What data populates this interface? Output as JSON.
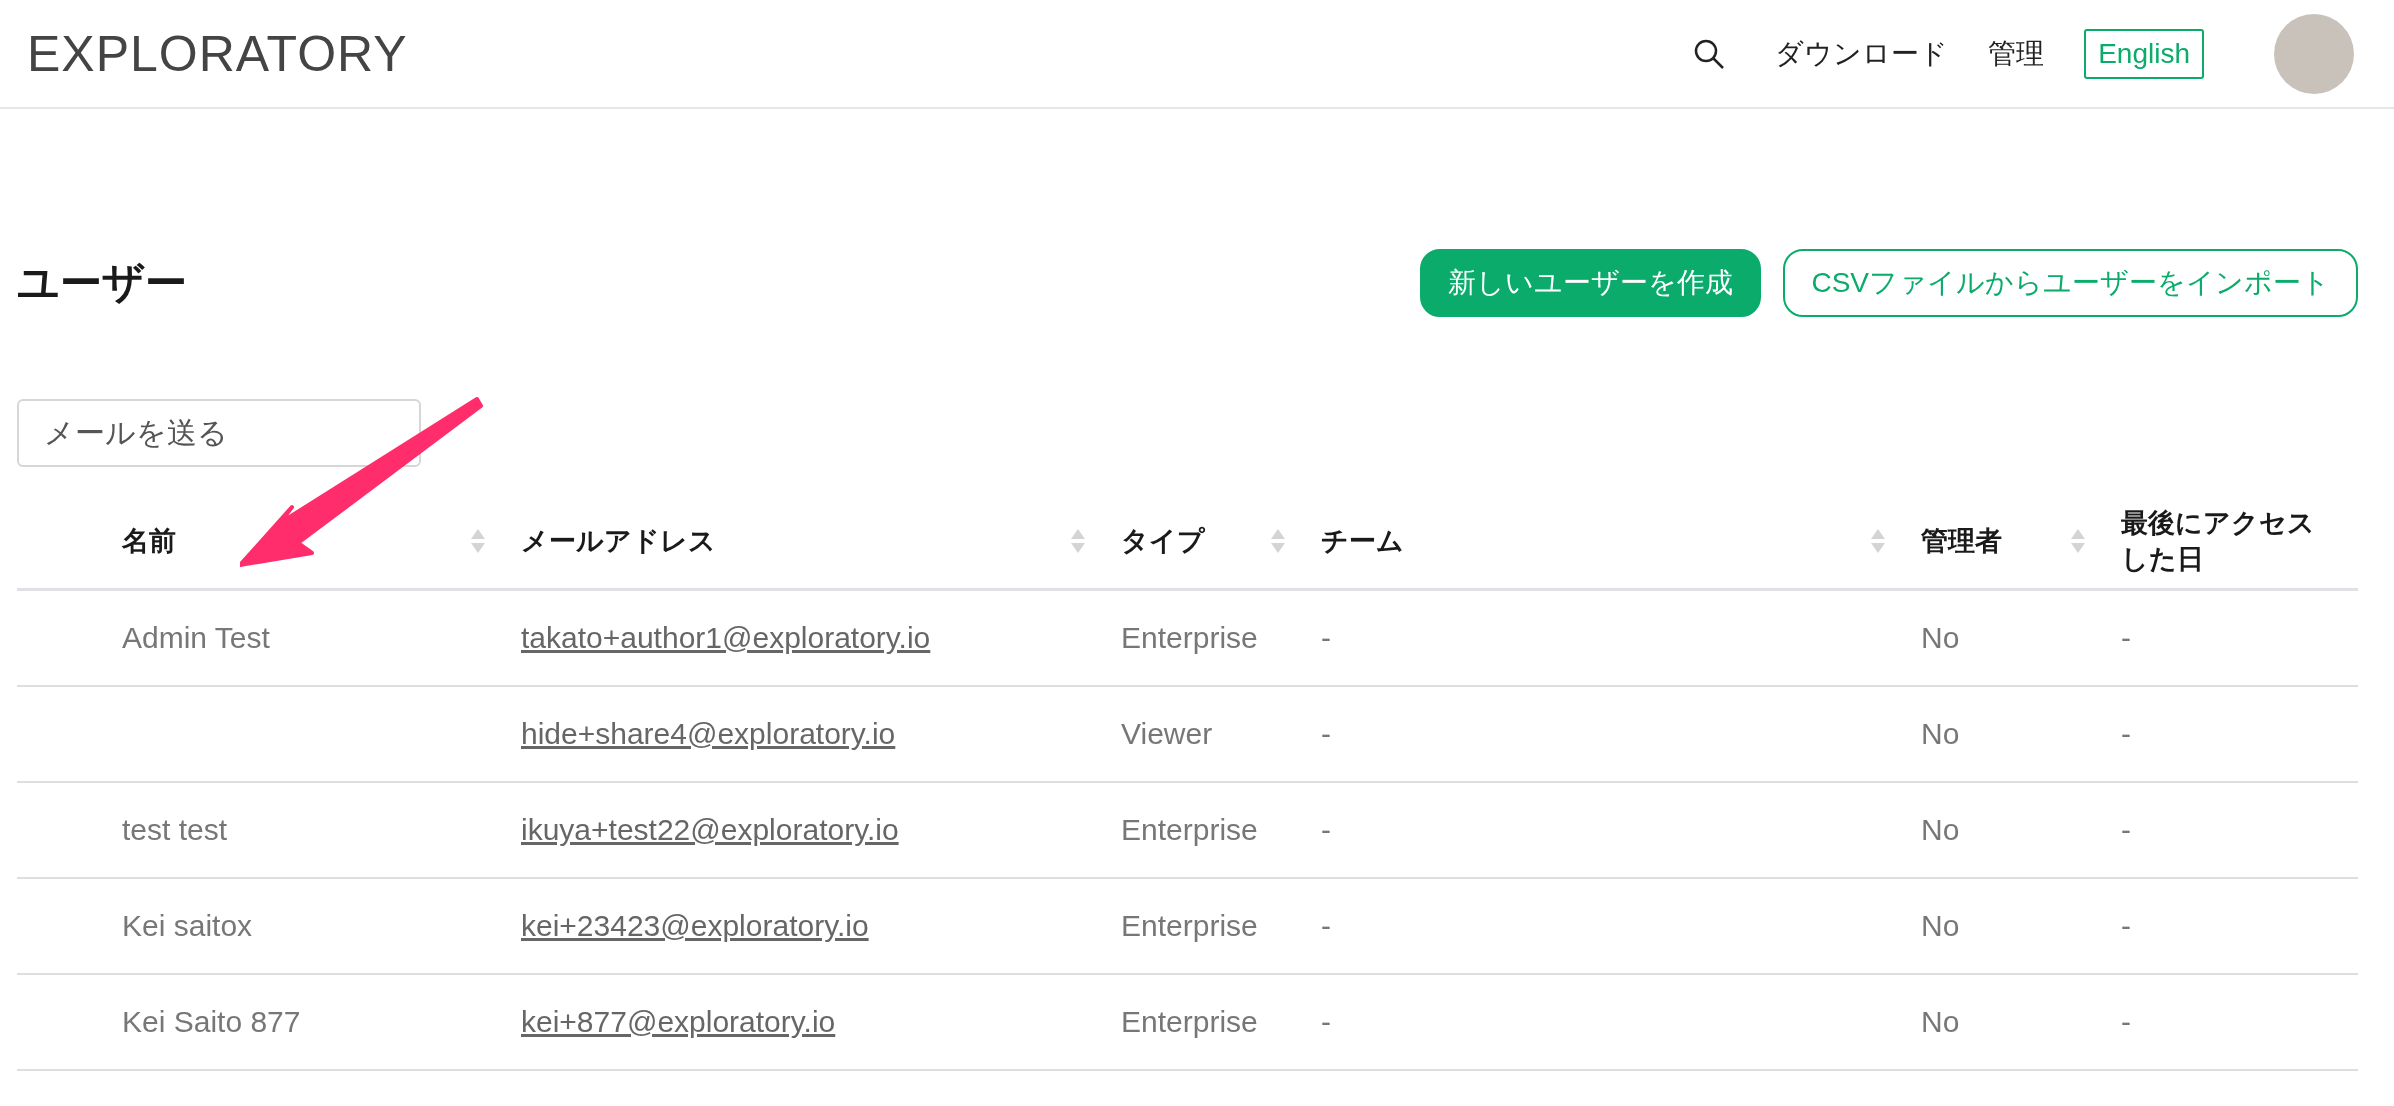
{
  "header": {
    "logo": "EXPLORATORY",
    "nav": [
      "ダウンロード",
      "管理"
    ],
    "language_button": "English"
  },
  "page": {
    "title": "ユーザー",
    "buttons": [
      {
        "label": "新しいユーザーを作成",
        "kind": "primary"
      },
      {
        "label": "CSVファイルからユーザーをインポート",
        "kind": "outline"
      }
    ],
    "send_mail_button": "メールを送る"
  },
  "table": {
    "columns": [
      {
        "label": "名前",
        "sortable": true
      },
      {
        "label": "メールアドレス",
        "sortable": true
      },
      {
        "label": "タイプ",
        "sortable": true
      },
      {
        "label": "チーム",
        "sortable": true
      },
      {
        "label": "管理者",
        "sortable": true
      },
      {
        "label": "最後にアクセスした日",
        "sortable": false
      }
    ],
    "rows": [
      [
        "Admin Test",
        "takato+author1@exploratory.io",
        "Enterprise",
        "-",
        "No",
        "-"
      ],
      [
        "",
        "hide+share4@exploratory.io",
        "Viewer",
        "-",
        "No",
        "-"
      ],
      [
        "test test",
        "ikuya+test22@exploratory.io",
        "Enterprise",
        "-",
        "No",
        "-"
      ],
      [
        "Kei saitox",
        "kei+23423@exploratory.io",
        "Enterprise",
        "-",
        "No",
        "-"
      ],
      [
        "Kei Saito 877",
        "kei+877@exploratory.io",
        "Enterprise",
        "-",
        "No",
        "-"
      ]
    ]
  }
}
